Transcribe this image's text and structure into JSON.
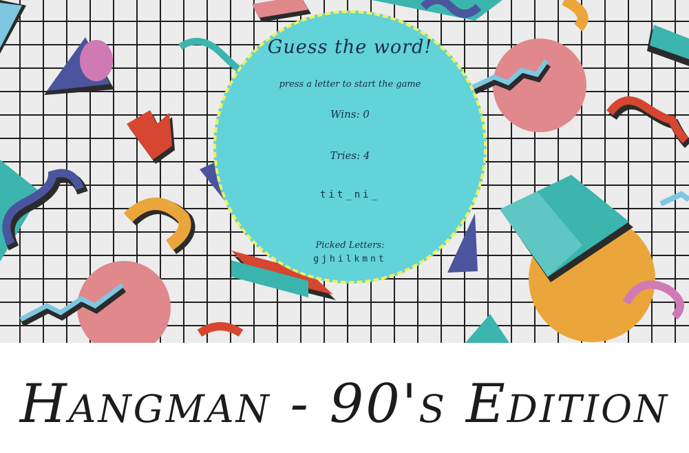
{
  "game": {
    "title": "Guess the word!",
    "subtitle": "press a letter to start the game",
    "wins": "Wins: 0",
    "tries": "Tries: 4",
    "word_display": "tit_ni_",
    "picked_label": "Picked Letters:",
    "picked_letters": "gjhilkmnt"
  },
  "page": {
    "heading": "Hangman - 90's Edition"
  },
  "colors": {
    "circle": "#62d3d8",
    "dashed_border": "#f2ef5a",
    "grid_bg": "#ececec",
    "grid_lines": "#1e1e1e",
    "pink": "#e0888c",
    "teal": "#3bb5ad",
    "orange": "#eaa63a",
    "navy": "#4b559e",
    "red": "#d64630"
  }
}
